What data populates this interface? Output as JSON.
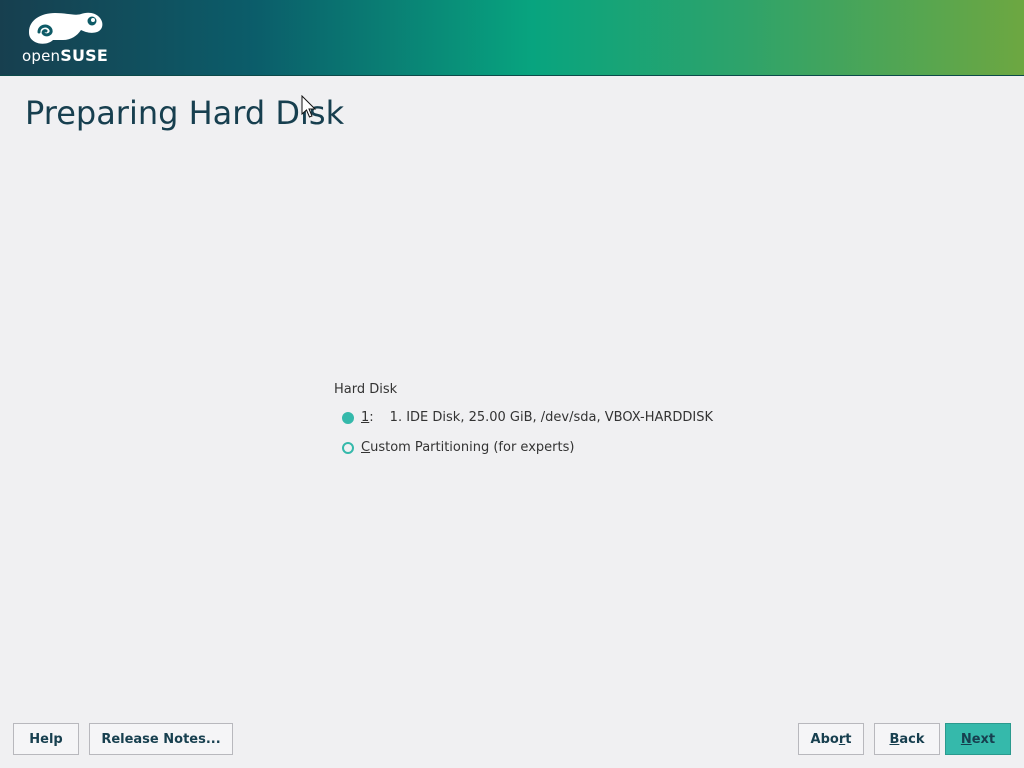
{
  "header": {
    "logo_text_prefix": "open",
    "logo_text_brand": "SUSE"
  },
  "page": {
    "title": "Preparing Hard Disk"
  },
  "disk_selection": {
    "group_label": "Hard Disk",
    "options": [
      {
        "shortcut": "1",
        "suffix": ":",
        "label": "1. IDE Disk, 25.00 GiB, /dev/sda, VBOX-HARDDISK",
        "selected": true
      },
      {
        "shortcut": "C",
        "label_rest": "ustom Partitioning (for experts)",
        "selected": false
      }
    ]
  },
  "buttons": {
    "help": "Help",
    "release_notes": "Release Notes...",
    "abort_pre": "Abo",
    "abort_key": "r",
    "abort_post": "t",
    "back_key": "B",
    "back_post": "ack",
    "next_key": "N",
    "next_post": "ext"
  },
  "colors": {
    "accent": "#35b9ab",
    "title": "#173f4f",
    "background": "#f0f0f2"
  }
}
